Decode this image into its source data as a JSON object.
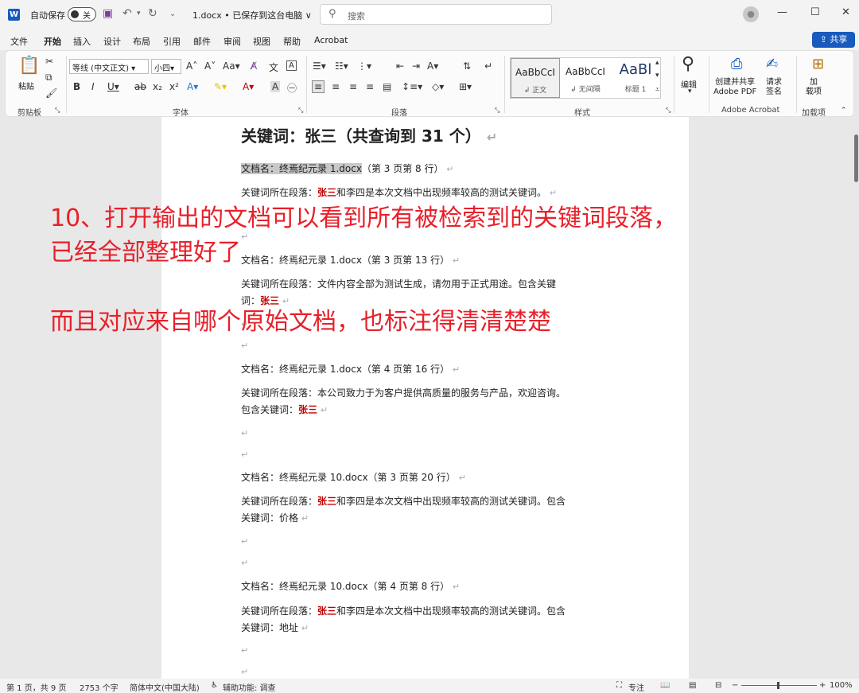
{
  "titlebar": {
    "autosave_label": "自动保存",
    "toggle_state": "关",
    "doc_title": "1.docx • 已保存到这台电脑 ∨",
    "search_placeholder": "搜索"
  },
  "menu": {
    "tabs": [
      "文件",
      "开始",
      "插入",
      "设计",
      "布局",
      "引用",
      "邮件",
      "审阅",
      "视图",
      "帮助",
      "Acrobat"
    ],
    "active_tab": "开始",
    "share_label": "共享"
  },
  "ribbon": {
    "clipboard": {
      "paste_label": "粘贴",
      "group_label": "剪贴板"
    },
    "font": {
      "font_name": "等线 (中文正文)",
      "font_size": "小四",
      "group_label": "字体"
    },
    "paragraph": {
      "group_label": "段落"
    },
    "styles": {
      "group_label": "样式",
      "items": [
        {
          "sample": "AaBbCcI",
          "name": "↲ 正文"
        },
        {
          "sample": "AaBbCcI",
          "name": "↲ 无间隔"
        },
        {
          "sample": "AaBl",
          "name": "标题 1"
        }
      ]
    },
    "editing": {
      "label": "编辑"
    },
    "acrobat": {
      "create_label": "创建并共享\nAdobe PDF",
      "sign_label": "请求\n签名",
      "group_label": "Adobe Acrobat"
    },
    "addins": {
      "label": "加\n载项",
      "group_label": "加载项"
    }
  },
  "document": {
    "heading": "关键词：张三（共查询到 31 个）",
    "entries": [
      {
        "docname_prefix": "文档名：终焉纪元录 1.docx",
        "docname_suffix": "（第 3 页第 8 行）",
        "para_before": "关键词所在段落：",
        "keyword": "张三",
        "para_after": "和李四是本次文档中出现频率较高的测试关键词。"
      },
      {
        "docname": "文档名：终焉纪元录 1.docx（第 3 页第 13 行）",
        "para_line1": "关键词所在段落：文件内容全部为测试生成，请勿用于正式用途。包含关键",
        "para_line2_prefix": "词：",
        "keyword": "张三"
      },
      {
        "docname": "文档名：终焉纪元录 1.docx（第 4 页第 16 行）",
        "para_line1": "关键词所在段落：本公司致力于为客户提供高质量的服务与产品，欢迎咨询。",
        "para_line2_prefix": "包含关键词：",
        "keyword": "张三"
      },
      {
        "docname": "文档名：终焉纪元录 10.docx（第 3 页第 20 行）",
        "para_before": "关键词所在段落：",
        "keyword": "张三",
        "para_after": "和李四是本次文档中出现频率较高的测试关键词。包含",
        "para_line2": "关键词：价格"
      },
      {
        "docname": "文档名：终焉纪元录 10.docx（第 4 页第 8 行）",
        "para_before": "关键词所在段落：",
        "keyword": "张三",
        "para_after": "和李四是本次文档中出现频率较高的测试关键词。包含",
        "para_line2": "关键词：地址"
      }
    ],
    "paragraph_mark": "↵"
  },
  "overlay": {
    "line1": "10、打开输出的文档可以看到所有被检索到的关键词段落，",
    "line2": "已经全部整理好了",
    "line3": "而且对应来自哪个原始文档，也标注得清清楚楚"
  },
  "status": {
    "page": "第 1 页，共 9 页",
    "words": "2753 个字",
    "language": "简体中文(中国大陆)",
    "accessibility": "辅助功能: 调查",
    "focus": "专注",
    "zoom": "100%"
  },
  "colors": {
    "accent": "#185abd",
    "keyword": "#c00000",
    "overlay": "#e8202a"
  }
}
